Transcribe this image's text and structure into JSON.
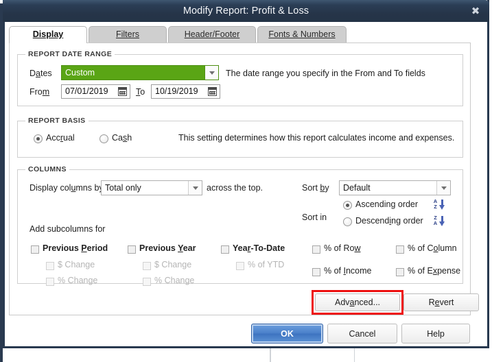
{
  "window": {
    "title": "Modify Report: Profit & Loss",
    "close_icon": "close-icon",
    "titlebar_color": "#263549",
    "border_color": "#28394f"
  },
  "tabs": [
    {
      "label": "Display",
      "accel": "D",
      "active": true
    },
    {
      "label": "Filters",
      "accel": "F",
      "active": false
    },
    {
      "label": "Header/Footer",
      "accel": "H",
      "active": false
    },
    {
      "label": "Fonts & Numbers",
      "accel": "n",
      "active": false
    }
  ],
  "report_date_range": {
    "group_title": "REPORT DATE RANGE",
    "dates_label": "Dates",
    "dates_value": "Custom",
    "dates_highlight_color": "#5aa515",
    "from_label": "From",
    "from_value": "07/01/2019",
    "to_label": "To",
    "to_value": "10/19/2019",
    "hint": "The date range you specify in the From and To fields",
    "calendar_icon": "calendar-icon",
    "dropdown_icon": "chevron-down-icon"
  },
  "report_basis": {
    "group_title": "REPORT BASIS",
    "options": [
      {
        "label": "Accrual",
        "selected": true
      },
      {
        "label": "Cash",
        "selected": false
      }
    ],
    "hint": "This setting determines how this report calculates income and expenses."
  },
  "columns": {
    "group_title": "COLUMNS",
    "display_columns_by_label": "Display columns by",
    "display_columns_by_value": "Total only",
    "across_the_top_label": "across the top.",
    "add_subcolumns_label": "Add subcolumns for",
    "subcolumn_groups": [
      {
        "header": {
          "label": "Previous Period",
          "checked": false,
          "enabled": true
        },
        "children": [
          {
            "label": "$ Change",
            "checked": false,
            "enabled": false
          },
          {
            "label": "% Change",
            "checked": false,
            "enabled": false
          }
        ]
      },
      {
        "header": {
          "label": "Previous Year",
          "checked": false,
          "enabled": true
        },
        "children": [
          {
            "label": "$ Change",
            "checked": false,
            "enabled": false
          },
          {
            "label": "% Change",
            "checked": false,
            "enabled": false
          }
        ]
      },
      {
        "header": {
          "label": "Year-To-Date",
          "checked": false,
          "enabled": true
        },
        "children": [
          {
            "label": "% of YTD",
            "checked": false,
            "enabled": false
          }
        ]
      }
    ],
    "percent_options": [
      {
        "label": "% of Row",
        "checked": false
      },
      {
        "label": "% of Column",
        "checked": false
      },
      {
        "label": "% of Income",
        "checked": false
      },
      {
        "label": "% of Expense",
        "checked": false
      }
    ],
    "sort_by_label": "Sort by",
    "sort_by_value": "Default",
    "sort_in_label": "Sort in",
    "sort_order_options": [
      {
        "label": "Ascending order",
        "selected": true,
        "icon": "sort-az-icon"
      },
      {
        "label": "Descending order",
        "selected": false,
        "icon": "sort-za-icon"
      }
    ]
  },
  "panel_buttons": {
    "advanced_label": "Advanced...",
    "revert_label": "Revert",
    "highlight_color": "#ee1111",
    "highlighted": "advanced-button"
  },
  "dialog_buttons": {
    "ok_label": "OK",
    "cancel_label": "Cancel",
    "help_label": "Help",
    "primary": "ok-button",
    "primary_color": "#4a80ca"
  }
}
